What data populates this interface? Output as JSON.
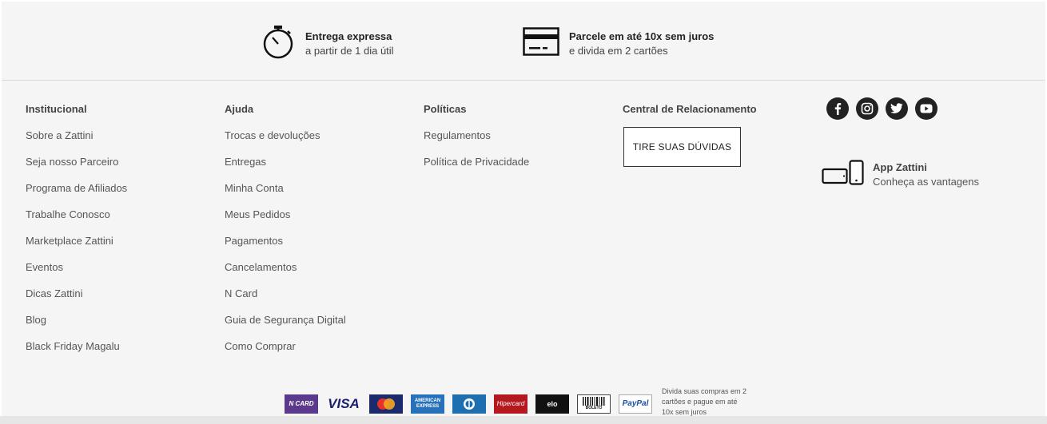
{
  "benefits": {
    "express": {
      "title": "Entrega expressa",
      "subtitle": "a partir de 1 dia útil",
      "icon": "stopwatch-icon"
    },
    "installments": {
      "title": "Parcele em até 10x sem juros",
      "subtitle": "e divida em 2 cartões",
      "icon": "credit-card-icon"
    }
  },
  "columns": {
    "institucional": {
      "title": "Institucional",
      "links": [
        "Sobre a Zattini",
        "Seja nosso Parceiro",
        "Programa de Afiliados",
        "Trabalhe Conosco",
        "Marketplace Zattini",
        "Eventos",
        "Dicas Zattini",
        "Blog",
        "Black Friday Magalu"
      ]
    },
    "ajuda": {
      "title": "Ajuda",
      "links": [
        "Trocas e devoluções",
        "Entregas",
        "Minha Conta",
        "Meus Pedidos",
        "Pagamentos",
        "Cancelamentos",
        "N Card",
        "Guia de Segurança Digital",
        "Como Comprar"
      ]
    },
    "politicas": {
      "title": "Políticas",
      "links": [
        "Regulamentos",
        "Política de Privacidade"
      ]
    },
    "central": {
      "title": "Central de Relacionamento",
      "button": "TIRE SUAS DÚVIDAS"
    }
  },
  "social": [
    "facebook-icon",
    "instagram-icon",
    "twitter-icon",
    "youtube-icon"
  ],
  "app": {
    "title": "App Zattini",
    "subtitle": "Conheça as vantagens"
  },
  "payments": {
    "methods": {
      "ncard": "N CARD",
      "visa": "VISA",
      "mastercard": "MasterCard",
      "amex": "AMERICAN EXPRESS",
      "diners": "Diners",
      "hipercard": "Hipercard",
      "elo": "elo",
      "boleto": "BOLETO",
      "paypal": "PayPal"
    },
    "note": "Divida suas compras em 2 cartões e pague em até 10x sem juros"
  }
}
